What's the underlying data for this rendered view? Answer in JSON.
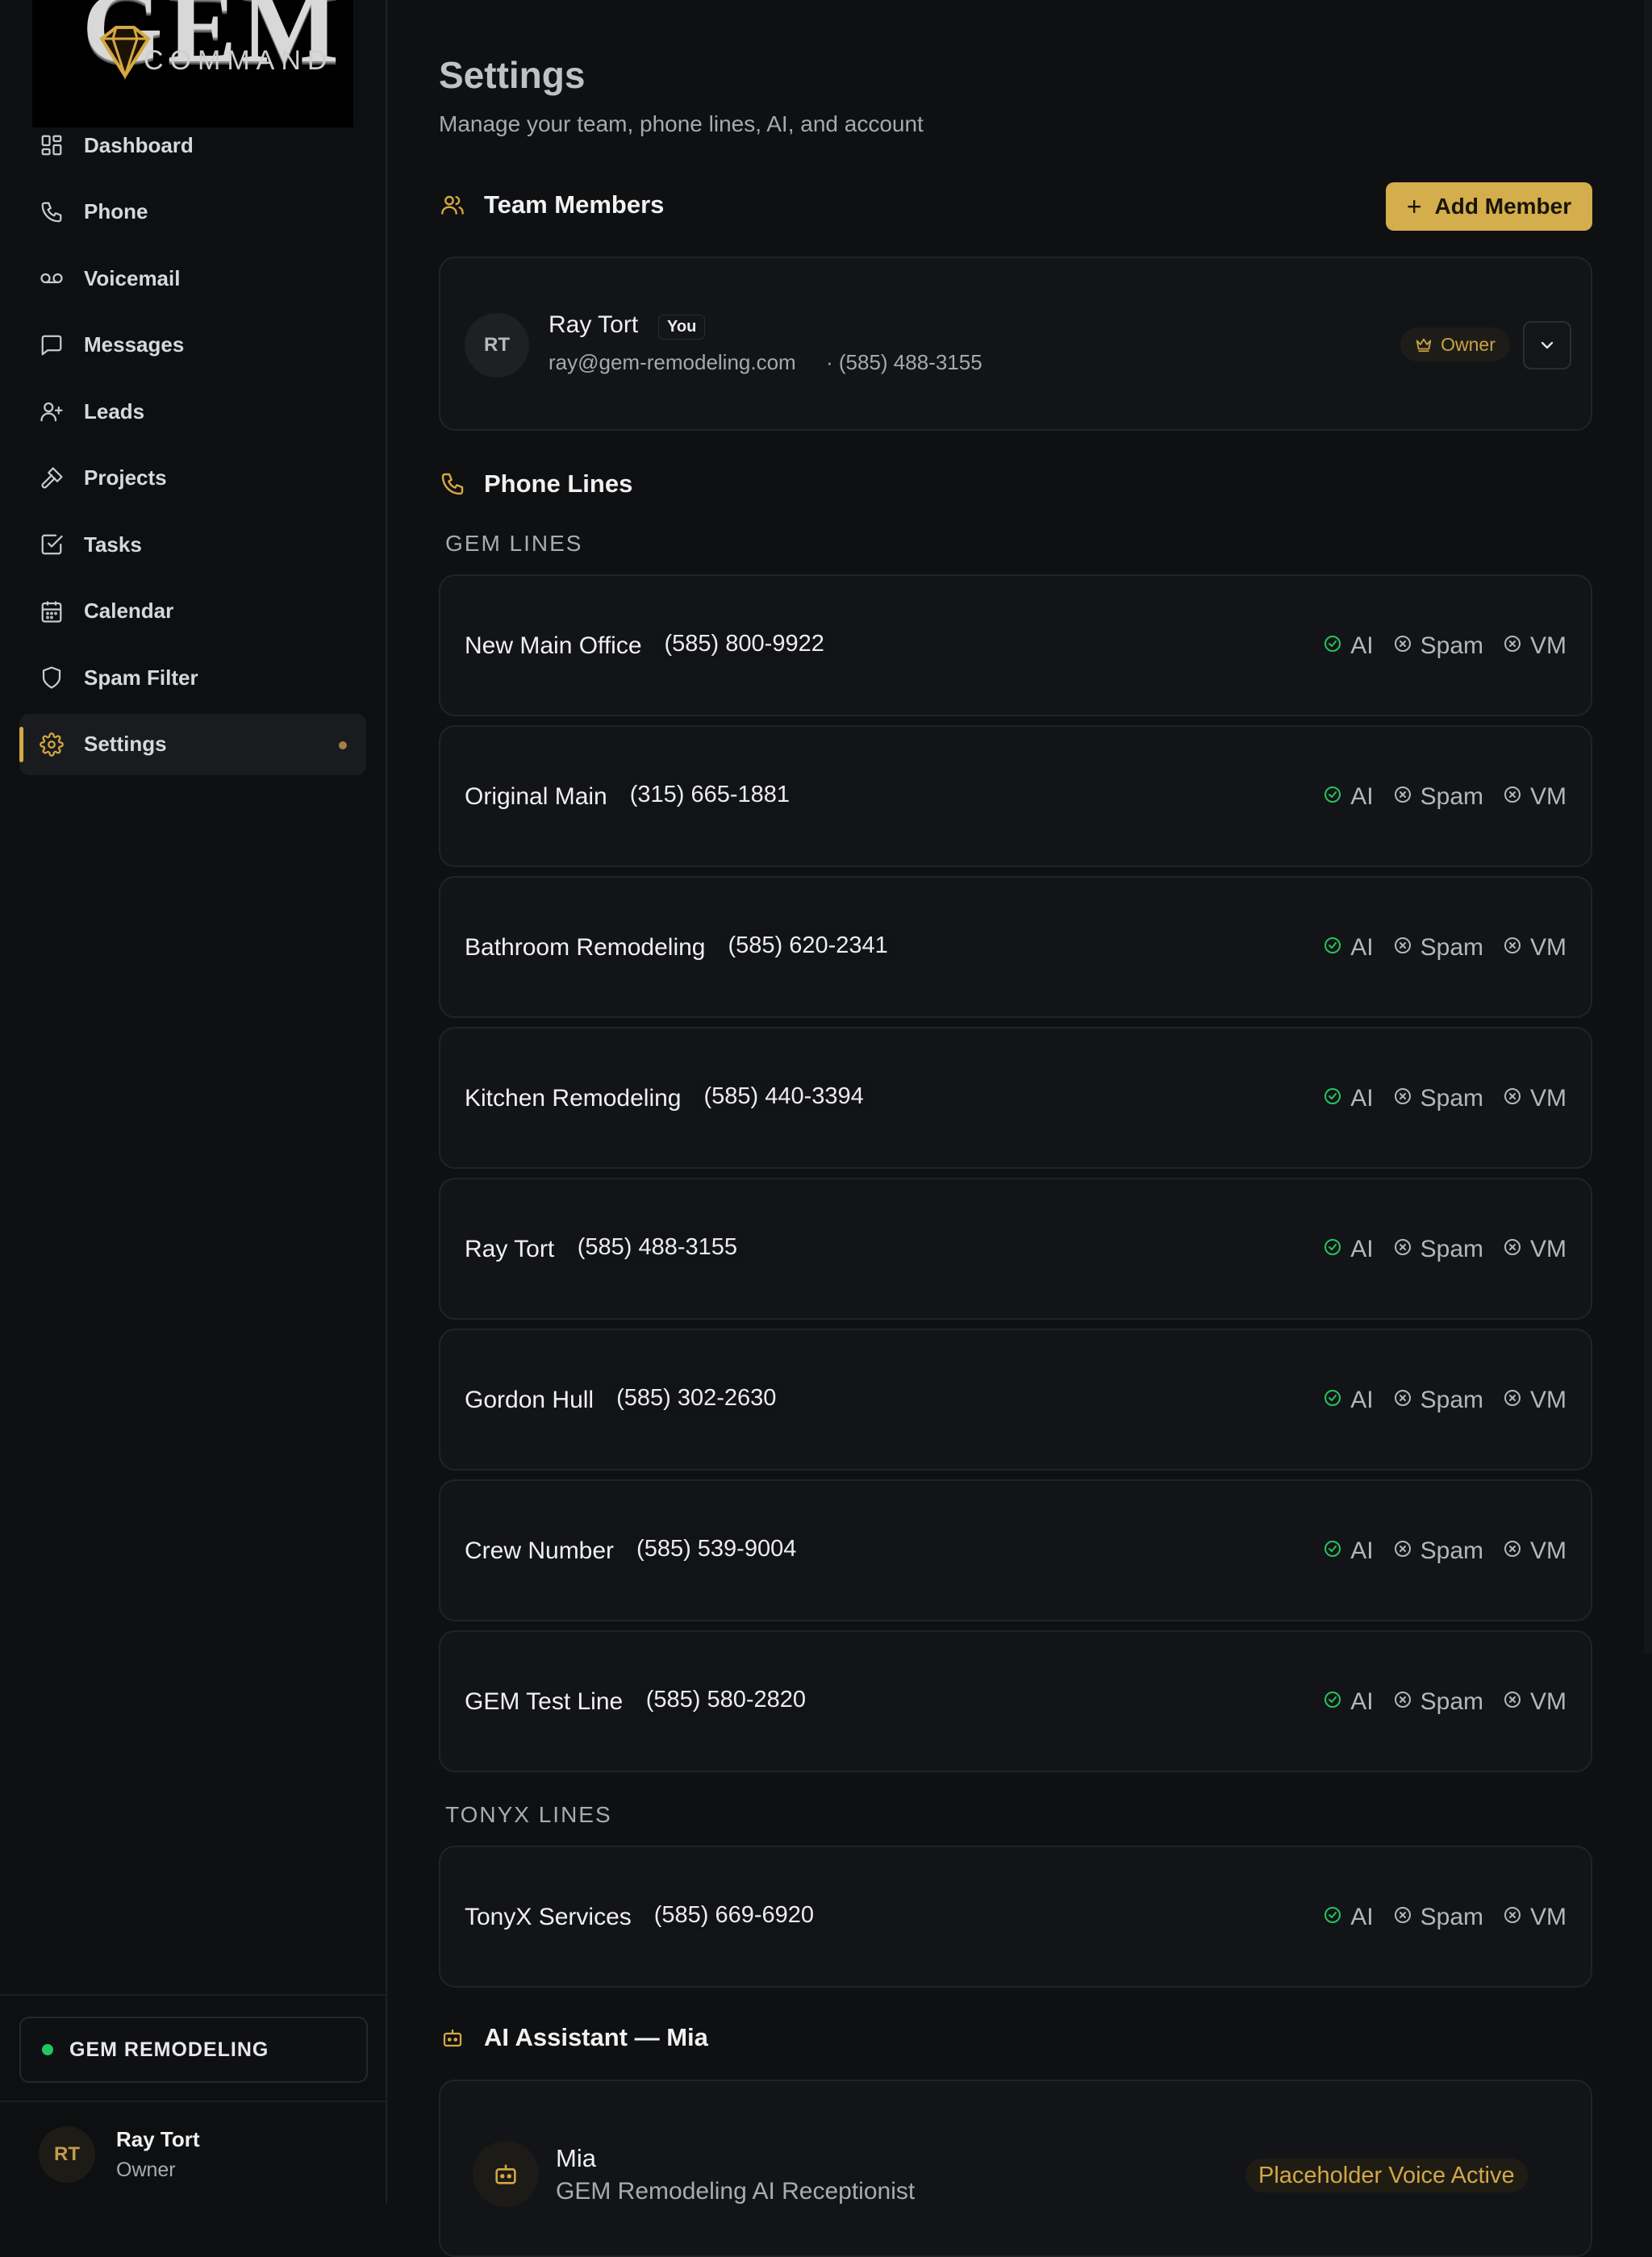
{
  "brand": {
    "logo_text": "GEM",
    "logo_sub": "COMMAND"
  },
  "nav": [
    {
      "label": "Dashboard",
      "icon": "dashboard-icon"
    },
    {
      "label": "Phone",
      "icon": "phone-icon"
    },
    {
      "label": "Voicemail",
      "icon": "voicemail-icon"
    },
    {
      "label": "Messages",
      "icon": "message-icon"
    },
    {
      "label": "Leads",
      "icon": "user-plus-icon"
    },
    {
      "label": "Projects",
      "icon": "hammer-icon"
    },
    {
      "label": "Tasks",
      "icon": "checkbox-icon"
    },
    {
      "label": "Calendar",
      "icon": "calendar-icon"
    },
    {
      "label": "Spam Filter",
      "icon": "shield-icon"
    },
    {
      "label": "Settings",
      "icon": "gear-icon",
      "active": true
    }
  ],
  "org": {
    "name": "GEM REMODELING",
    "status_color": "#22c55e"
  },
  "current_user": {
    "initials": "RT",
    "name": "Ray Tort",
    "role": "Owner"
  },
  "page": {
    "title": "Settings",
    "subtitle": "Manage your team, phone lines, AI, and account"
  },
  "team": {
    "title": "Team Members",
    "add_label": "Add Member",
    "members": [
      {
        "initials": "RT",
        "name": "Ray Tort",
        "you": "You",
        "email": "ray@gem-remodeling.com",
        "phone": "· (585) 488-3155",
        "role": "Owner"
      }
    ]
  },
  "phone_lines": {
    "title": "Phone Lines",
    "groups": [
      {
        "label": "GEM LINES",
        "lines": [
          {
            "name": "New Main Office",
            "number": "(585) 800-9922"
          },
          {
            "name": "Original Main",
            "number": "(315) 665-1881"
          },
          {
            "name": "Bathroom Remodeling",
            "number": "(585) 620-2341"
          },
          {
            "name": "Kitchen Remodeling",
            "number": "(585) 440-3394"
          },
          {
            "name": "Ray Tort",
            "number": "(585) 488-3155"
          },
          {
            "name": "Gordon Hull",
            "number": "(585) 302-2630"
          },
          {
            "name": "Crew Number",
            "number": "(585) 539-9004"
          },
          {
            "name": "GEM Test Line",
            "number": "(585) 580-2820"
          }
        ]
      },
      {
        "label": "TONYX LINES",
        "lines": [
          {
            "name": "TonyX Services",
            "number": "(585) 669-6920"
          }
        ]
      }
    ],
    "flags": {
      "ai": "AI",
      "spam": "Spam",
      "vm": "VM"
    },
    "colors": {
      "on": "#22c55e",
      "off": "#b4b6ba"
    }
  },
  "ai": {
    "title": "AI Assistant — Mia",
    "name": "Mia",
    "description": "GEM Remodeling AI Receptionist",
    "status": "Placeholder Voice Active"
  },
  "colors": {
    "accent": "#d4ad4c",
    "background": "#0f1012",
    "card": "#131417"
  }
}
